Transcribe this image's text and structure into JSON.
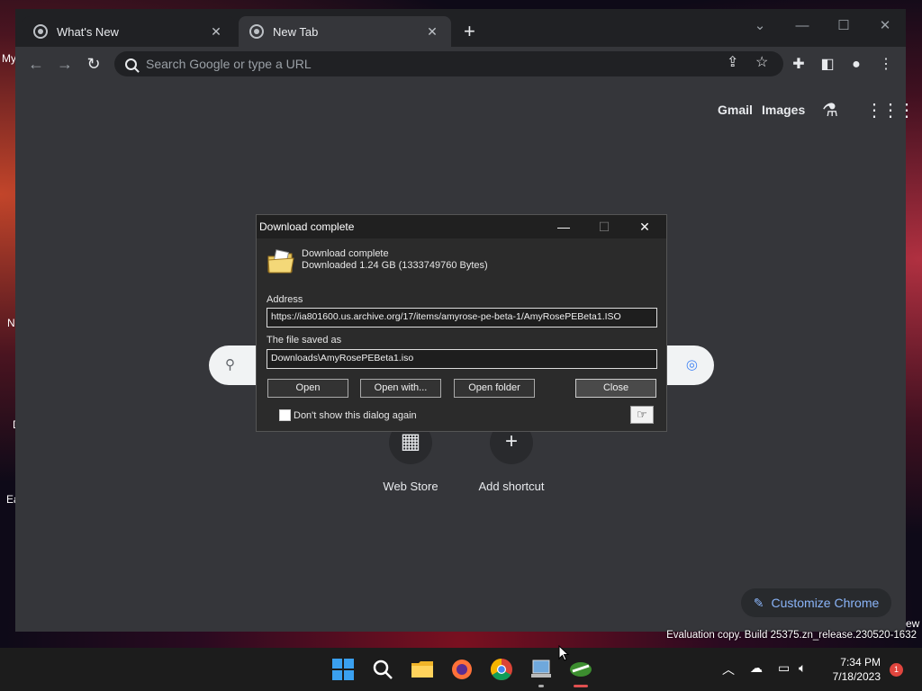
{
  "desktop": {
    "fragments": [
      "My",
      "N",
      "D",
      "Ea",
      "ew"
    ]
  },
  "browser": {
    "tabs": [
      {
        "label": "What's New",
        "active": false
      },
      {
        "label": "New Tab",
        "active": true
      }
    ],
    "new_tab_symbol": "+",
    "window_controls": {
      "dropdown": "⌄",
      "minimize": "—",
      "maximize": "☐",
      "close": "✕"
    },
    "omnibox_placeholder": "Search Google or type a URL",
    "ntp": {
      "gmail": "Gmail",
      "images": "Images",
      "shortcuts": [
        {
          "label": "Web Store"
        },
        {
          "label": "Add shortcut",
          "symbol": "+"
        }
      ],
      "customize": "Customize Chrome"
    }
  },
  "dialog": {
    "title": "Download complete",
    "heading": "Download complete",
    "detail": "Downloaded 1.24 GB (1333749760 Bytes)",
    "address_label": "Address",
    "address_value": "https://ia801600.us.archive.org/17/items/amyrose-pe-beta-1/AmyRosePEBeta1.ISO",
    "saved_label": "The file saved as",
    "saved_value": "Downloads\\AmyRosePEBeta1.iso",
    "buttons": {
      "open": "Open",
      "open_with": "Open with...",
      "open_folder": "Open folder",
      "close": "Close"
    },
    "dont_show": "Don't show this dialog again"
  },
  "watermark": "Evaluation copy. Build 25375.zn_release.230520-1632",
  "taskbar": {
    "time": "7:34 PM",
    "date": "7/18/2023",
    "notification_count": "1",
    "apps": [
      "windows-start-icon",
      "search-icon",
      "file-explorer-icon",
      "firefox-icon",
      "chrome-icon",
      "remote-desktop-icon",
      "idm-icon"
    ]
  },
  "colors": {
    "chrome_bg": "#35363a",
    "tabbar_bg": "#202124",
    "accent_link": "#8ab4f8",
    "notification": "#e0453e"
  }
}
